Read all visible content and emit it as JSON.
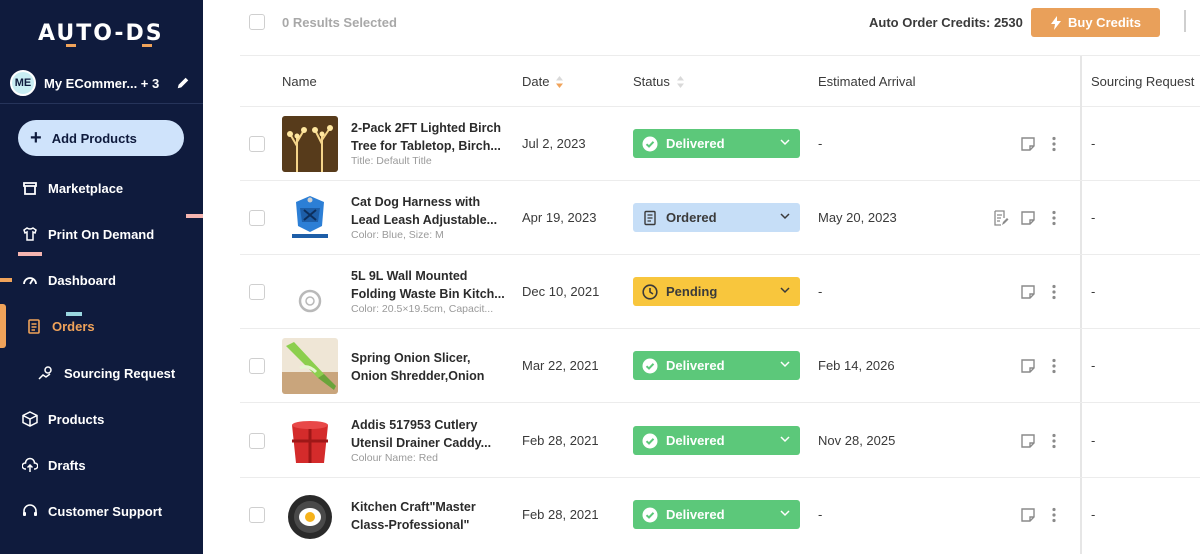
{
  "sidebar": {
    "logo": "AUTO-DS",
    "store_avatar": "ME",
    "store_name": "My ECommer... + 3",
    "add_products_label": "Add Products",
    "items": [
      {
        "label": "Marketplace",
        "icon": "store-icon"
      },
      {
        "label": "Print On Demand",
        "icon": "tshirt-icon"
      },
      {
        "label": "Dashboard",
        "icon": "gauge-icon"
      },
      {
        "label": "Orders",
        "icon": "clipboard-icon",
        "active": true
      },
      {
        "label": "Sourcing Request",
        "icon": "sourcing-icon"
      },
      {
        "label": "Products",
        "icon": "box-icon"
      },
      {
        "label": "Drafts",
        "icon": "cloud-upload-icon"
      },
      {
        "label": "Customer Support",
        "icon": "headset-icon"
      }
    ]
  },
  "header": {
    "results_selected": "0 Results Selected",
    "credits": "Auto Order Credits: 2530",
    "buy_credits": "Buy Credits"
  },
  "table": {
    "columns": [
      "Name",
      "Date",
      "Status",
      "Estimated Arrival",
      "Sourcing Request"
    ],
    "rows": [
      {
        "title": "2-Pack 2FT Lighted Birch Tree for Tabletop, Birch...",
        "variant": "Title: Default Title",
        "date": "Jul 2, 2023",
        "status": "Delivered",
        "arrival": "-",
        "sourcing": "-"
      },
      {
        "title": "Cat Dog Harness with Lead Leash Adjustable...",
        "variant": "Color: Blue, Size: M",
        "date": "Apr 19, 2023",
        "status": "Ordered",
        "arrival": "May 20, 2023",
        "sourcing": "-"
      },
      {
        "title": "5L 9L Wall Mounted Folding Waste Bin Kitch...",
        "variant": "Color: 20.5×19.5cm, Capacit...",
        "date": "Dec 10, 2021",
        "status": "Pending",
        "arrival": "-",
        "sourcing": "-"
      },
      {
        "title": "Spring Onion Slicer, Onion Shredder,Onion Slicer...",
        "variant": "",
        "date": "Mar 22, 2021",
        "status": "Delivered",
        "arrival": "Feb 14, 2026",
        "sourcing": "-"
      },
      {
        "title": "Addis 517953 Cutlery Utensil Drainer Caddy...",
        "variant": "Colour Name: Red",
        "date": "Feb 28, 2021",
        "status": "Delivered",
        "arrival": "Nov 28, 2025",
        "sourcing": "-"
      },
      {
        "title": "Kitchen Craft\"Master Class-Professional\" Egg...",
        "variant": "",
        "date": "Feb 28, 2021",
        "status": "Delivered",
        "arrival": "-",
        "sourcing": "-"
      }
    ]
  },
  "colors": {
    "sidebar_bg": "#0f1b3d",
    "accent": "#f0a35a",
    "delivered": "#5cc87a",
    "ordered": "#c6def7",
    "pending": "#f8c63d"
  }
}
